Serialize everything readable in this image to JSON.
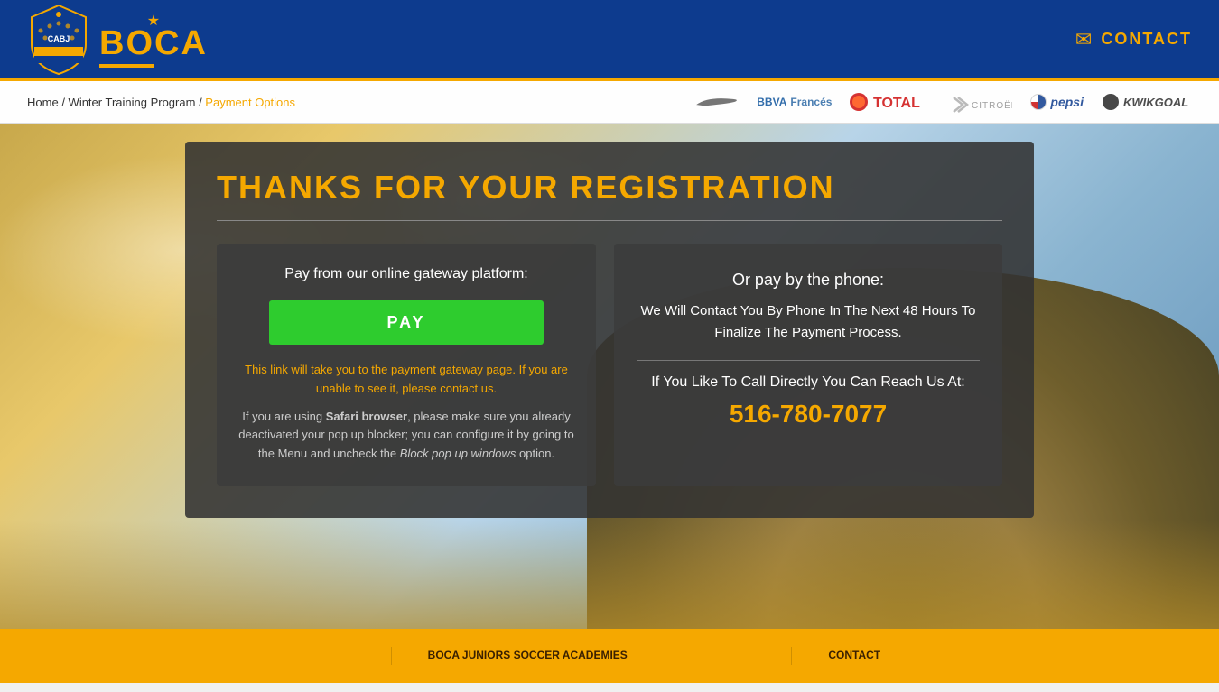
{
  "header": {
    "logo_text": "BOCA",
    "contact_label": "CONTACT"
  },
  "breadcrumb": {
    "home": "Home",
    "separator1": " / ",
    "program": "Winter Training Program",
    "separator2": " / ",
    "current": "Payment Options"
  },
  "sponsors": [
    {
      "name": "Nike",
      "type": "nike"
    },
    {
      "name": "BBVA Francés",
      "type": "bbva"
    },
    {
      "name": "TOTAL",
      "type": "total"
    },
    {
      "name": "Citroën",
      "type": "citroen"
    },
    {
      "name": "pepsi",
      "type": "pepsi"
    },
    {
      "name": "KWIKGOAL",
      "type": "kwikgoal"
    }
  ],
  "main": {
    "title": "THANKS FOR YOUR REGISTRATION",
    "left_panel": {
      "gateway_label": "Pay from our online gateway platform:",
      "pay_button": "PAY",
      "warning_orange": "This link will take you to the payment gateway page. If you are unable to see it, please contact us.",
      "warning_normal1": "If you are using ",
      "warning_bold": "Safari browser",
      "warning_normal2": ", please make sure you already deactivated your pop up blocker; you can configure it by going to the Menu and uncheck the ",
      "warning_italic": "Block pop up windows",
      "warning_end": " option."
    },
    "right_panel": {
      "phone_title": "Or pay by the phone:",
      "phone_desc": "We Will Contact You By Phone In The Next 48 Hours To Finalize The Payment Process.",
      "direct_label": "If You Like To Call Directly You Can Reach Us At:",
      "phone_number": "516-780-7077"
    }
  },
  "footer": {
    "col1": "",
    "col2": "BOCA JUNIORS SOCCER ACADEMIES",
    "col3": "CONTACT"
  }
}
